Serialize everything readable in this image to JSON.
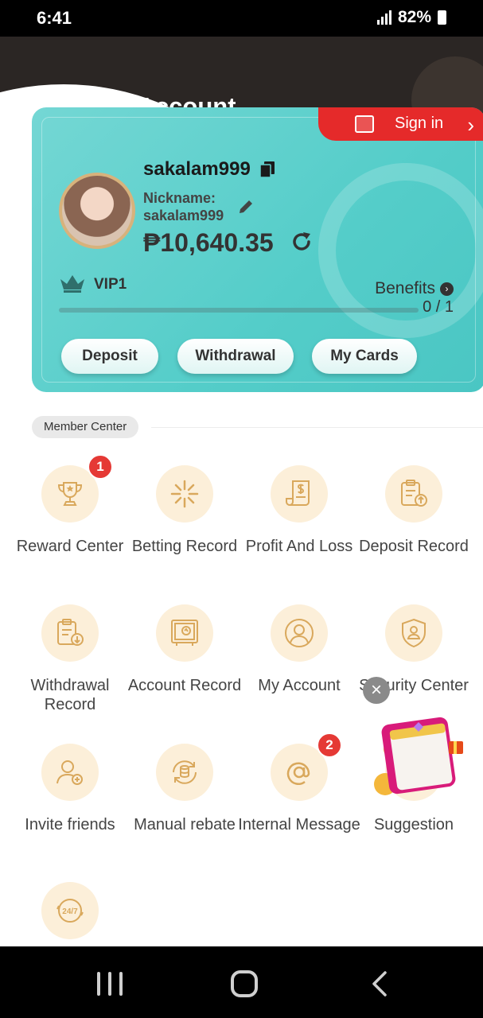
{
  "status": {
    "time": "6:41",
    "battery": "82%"
  },
  "header": {
    "title": "My Account"
  },
  "card": {
    "signin_label": "Sign in",
    "username": "sakalam999",
    "nickname_label": "Nickname:",
    "nickname_value": "sakalam999",
    "balance": "₱10,640.35",
    "vip_label": "VIP1",
    "benefits_label": "Benefits",
    "progress_text": "0 / 1",
    "progress_value": 0,
    "buttons": {
      "deposit": "Deposit",
      "withdrawal": "Withdrawal",
      "cards": "My Cards"
    }
  },
  "member_center": {
    "title": "Member Center",
    "items": [
      {
        "label": "Reward Center",
        "icon": "trophy-icon",
        "badge": "1"
      },
      {
        "label": "Betting Record",
        "icon": "betting-record-icon"
      },
      {
        "label": "Profit And Loss",
        "icon": "receipt-dollar-icon"
      },
      {
        "label": "Deposit Record",
        "icon": "clipboard-upload-icon"
      },
      {
        "label": "Withdrawal Record",
        "icon": "clipboard-download-icon"
      },
      {
        "label": "Account Record",
        "icon": "account-record-icon"
      },
      {
        "label": "My Account",
        "icon": "user-circle-icon"
      },
      {
        "label": "Security Center",
        "icon": "shield-user-icon"
      },
      {
        "label": "Invite friends",
        "icon": "add-user-icon"
      },
      {
        "label": "Manual rebate",
        "icon": "coins-rebate-icon"
      },
      {
        "label": "Internal Message",
        "icon": "at-sign-icon",
        "badge": "2"
      },
      {
        "label": "Suggestion",
        "icon": "suggestion-icon"
      },
      {
        "label": "",
        "icon": "support-24-7-icon"
      }
    ]
  },
  "colors": {
    "card": "#54cdc9",
    "signin": "#e52a2a",
    "icon_bg": "#fcefd9",
    "icon_stroke": "#d9a85c",
    "badge": "#e53935"
  }
}
